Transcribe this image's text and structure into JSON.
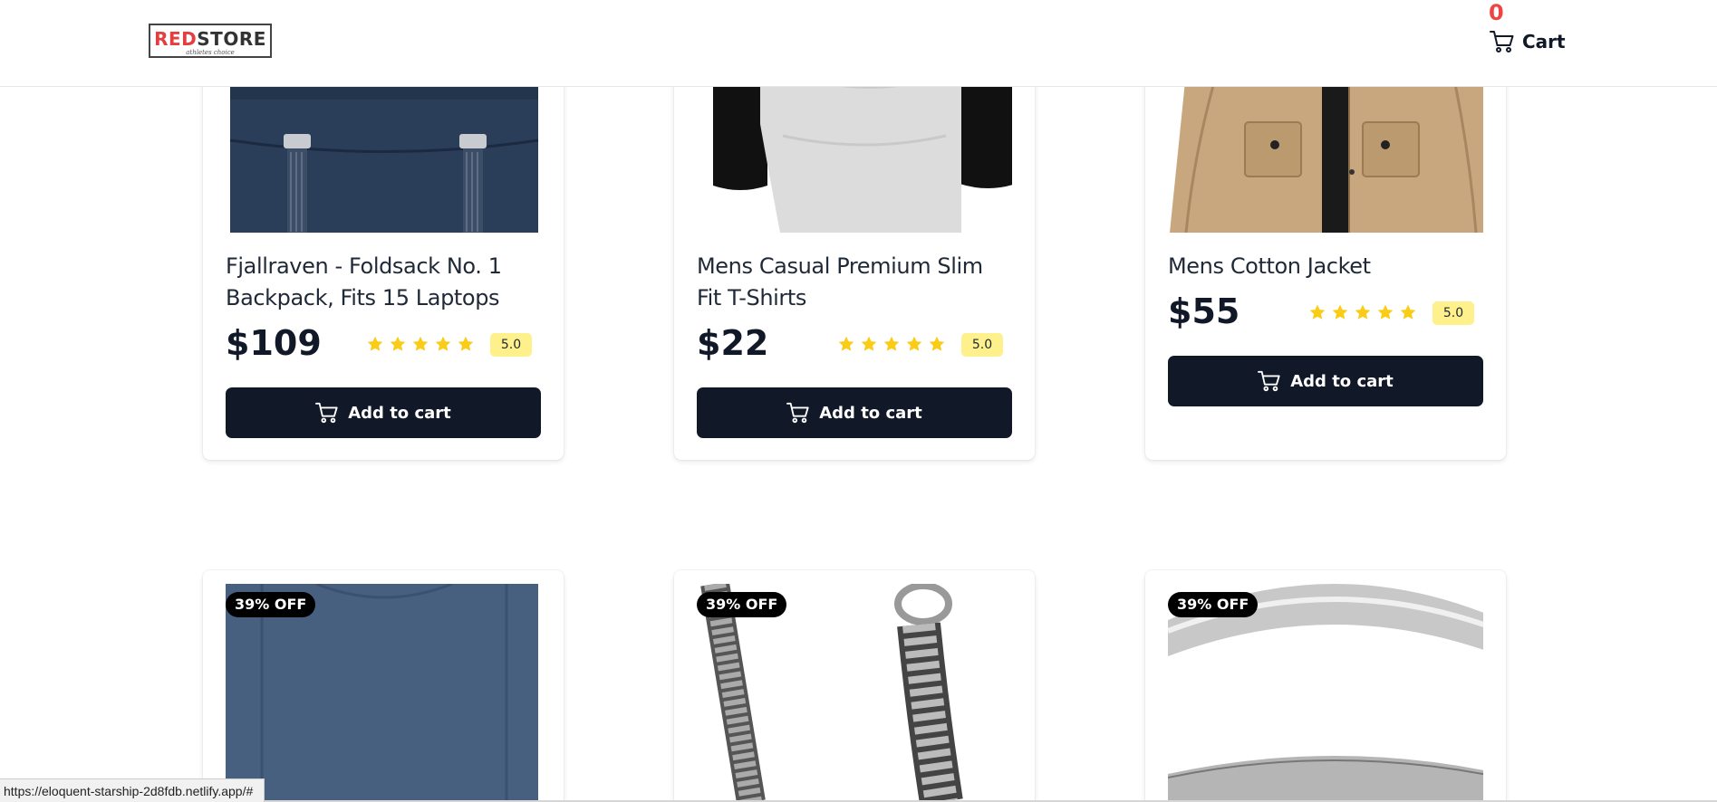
{
  "header": {
    "logo_main_a": "RED",
    "logo_main_b": "STORE",
    "logo_sub": "athletes choice",
    "cart_count": "0",
    "cart_label": "Cart"
  },
  "products_row1": [
    {
      "title": "Fjallraven - Foldsack No. 1 Backpack, Fits 15 Laptops",
      "price": "$109",
      "rating": "5.0",
      "stars": 5,
      "button": "Add to cart"
    },
    {
      "title": "Mens Casual Premium Slim Fit T-Shirts",
      "price": "$22",
      "rating": "5.0",
      "stars": 5,
      "button": "Add to cart"
    },
    {
      "title": "Mens Cotton Jacket",
      "price": "$55",
      "rating": "5.0",
      "stars": 5,
      "button": "Add to cart"
    }
  ],
  "products_row2": [
    {
      "badge": "39% OFF"
    },
    {
      "badge": "39% OFF"
    },
    {
      "badge": "39% OFF"
    }
  ],
  "status_bar": {
    "url": "https://eloquent-starship-2d8fdb.netlify.app/#"
  },
  "colors": {
    "accent": "#111827",
    "cart_count": "#ef4444",
    "rating_bg": "#fef08a",
    "star": "#facc15"
  }
}
